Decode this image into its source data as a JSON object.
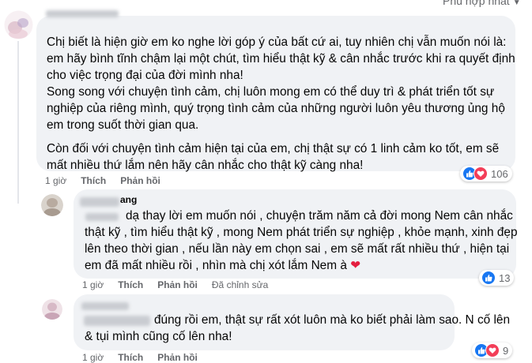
{
  "header": {
    "sort_label": "Phù hợp nhất"
  },
  "comments": [
    {
      "paragraphs": [
        "Chị biết là hiện giờ em ko nghe lời góp ý của bất cứ ai, tuy nhiên chị vẫn muốn nói là:",
        "em hãy bình tĩnh chậm lại một chút, tìm hiểu thật kỹ & cân nhắc trước khi ra quyết định",
        "cho việc trọng đại của đời mình nha!",
        "Song song với chuyện tình cảm, chị luôn mong em có thể duy trì & phát triển tốt sự",
        "nghiệp của riêng mình, quý trọng tình cảm của những người luôn yêu thương ủng hộ",
        "em trong suốt thời gian qua.",
        "Còn đối với chuyện tình cảm hiện tại của em, chị thật sự có 1 linh cảm ko tốt, em sẽ",
        "mất nhiều thứ lắm nên hãy cân nhắc cho thật kỹ càng nha!"
      ],
      "time": "1 giờ",
      "like_label": "Thích",
      "reply_label": "Phản hồi",
      "reaction_count": "106"
    },
    {
      "author_suffix": "ang",
      "lines": [
        "dạ thay lời em muốn nói , chuyện trăm năm cả đời mong Nem cân nhắc",
        "thật kỹ , tìm hiểu thật kỹ , mong Nem phát triển sự nghiệp , khỏe mạnh, xinh đẹp",
        "lên theo thời gian , nếu lần này em chọn sai , em sẽ mất rất nhiều thứ , hiện tại",
        "em đã mất nhiều rồi , nhìn mà chị xót lắm Nem à"
      ],
      "time": "1 giờ",
      "like_label": "Thích",
      "reply_label": "Phản hồi",
      "edited_label": "Đã chỉnh sửa",
      "reaction_count": "13"
    },
    {
      "lines": [
        "đúng rồi em, thật sự rất xót luôn mà ko biết phải làm sao. N cố lên",
        "& tụi mình cũng cố lên nha!"
      ],
      "time": "1 giờ",
      "like_label": "Thích",
      "reply_label": "Phản hồi",
      "reaction_count": "9"
    }
  ],
  "colors": {
    "like": "#1877f2",
    "love": "#f33e58",
    "heart": "#e41e3f"
  }
}
